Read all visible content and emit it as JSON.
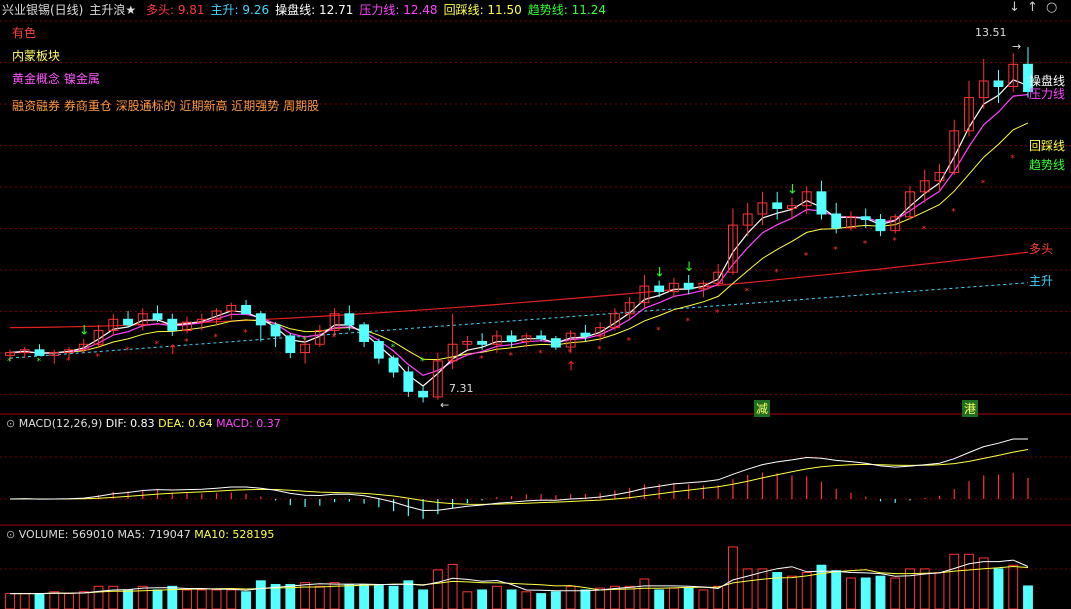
{
  "header": {
    "stock": "兴业银锡(日线)",
    "indicator": "主升浪★",
    "items": [
      {
        "label": "多头:",
        "value": "9.81",
        "color": "#ff3a3a"
      },
      {
        "label": "主升:",
        "value": "9.26",
        "color": "#3fd6ff"
      },
      {
        "label": "操盘线:",
        "value": "12.71",
        "color": "#ffffff"
      },
      {
        "label": "压力线:",
        "value": "12.48",
        "color": "#ff44ff"
      },
      {
        "label": "回踩线:",
        "value": "11.50",
        "color": "#ffff44"
      },
      {
        "label": "趋势线:",
        "value": "11.24",
        "color": "#33ff33"
      }
    ],
    "controls": [
      "↓",
      "↑",
      "○"
    ]
  },
  "tags": {
    "t1": "有色",
    "t2": "内蒙板块",
    "t3": "黄金概念 镍金属",
    "t4": "融资融券 券商重仓 深股通标的 近期新高 近期强势 周期股"
  },
  "labels": {
    "high": "13.51",
    "low": "7.31",
    "line1": "操盘线",
    "line2": "压力线",
    "line3": "回踩线",
    "line4": "趋势线",
    "line5": "多头",
    "line6": "主升",
    "mark1": "减",
    "mark2": "港"
  },
  "macd": {
    "name": "MACD(12,26,9)",
    "dif": "DIF: 0.83",
    "dea": "DEA: 0.64",
    "macd": "MACD: 0.37"
  },
  "volume": {
    "name": "VOLUME: 569010",
    "ma5": "MA5: 719047",
    "ma10": "MA10: 528195"
  },
  "colors": {
    "up": "#ff3333",
    "down": "#54ffff",
    "grid": "#7a0000",
    "bg": "#000000"
  },
  "chart_data": {
    "type": "candlestick",
    "y_range_price": [
      7.0,
      14.0
    ],
    "candles": [
      [
        7.95,
        8.05,
        7.85,
        8.0
      ],
      [
        8.0,
        8.1,
        7.9,
        8.05
      ],
      [
        8.05,
        8.15,
        7.95,
        7.95
      ],
      [
        7.95,
        8.05,
        7.8,
        8.0
      ],
      [
        8.0,
        8.1,
        7.9,
        8.05
      ],
      [
        8.05,
        8.25,
        8.0,
        8.15
      ],
      [
        8.15,
        8.5,
        8.1,
        8.4
      ],
      [
        8.4,
        8.7,
        8.3,
        8.6
      ],
      [
        8.6,
        8.75,
        8.45,
        8.5
      ],
      [
        8.5,
        8.8,
        8.4,
        8.7
      ],
      [
        8.7,
        8.85,
        8.55,
        8.6
      ],
      [
        8.6,
        8.7,
        8.3,
        8.4
      ],
      [
        8.4,
        8.65,
        8.35,
        8.55
      ],
      [
        8.55,
        8.7,
        8.4,
        8.6
      ],
      [
        8.6,
        8.8,
        8.5,
        8.75
      ],
      [
        8.75,
        8.9,
        8.6,
        8.85
      ],
      [
        8.85,
        8.95,
        8.7,
        8.7
      ],
      [
        8.7,
        8.75,
        8.2,
        8.5
      ],
      [
        8.5,
        8.55,
        8.1,
        8.3
      ],
      [
        8.3,
        8.35,
        7.9,
        8.0
      ],
      [
        8.0,
        8.3,
        7.8,
        8.15
      ],
      [
        8.15,
        8.5,
        8.1,
        8.4
      ],
      [
        8.4,
        8.8,
        8.3,
        8.7
      ],
      [
        8.7,
        8.85,
        8.4,
        8.5
      ],
      [
        8.5,
        8.55,
        8.1,
        8.2
      ],
      [
        8.2,
        8.25,
        7.8,
        7.9
      ],
      [
        7.9,
        7.95,
        7.55,
        7.65
      ],
      [
        7.65,
        7.75,
        7.2,
        7.3
      ],
      [
        7.3,
        7.4,
        7.1,
        7.2
      ],
      [
        7.2,
        8.0,
        7.15,
        7.85
      ],
      [
        7.85,
        8.7,
        7.7,
        8.15
      ],
      [
        8.15,
        8.3,
        8.05,
        8.2
      ],
      [
        8.2,
        8.35,
        8.05,
        8.15
      ],
      [
        8.15,
        8.4,
        8.0,
        8.3
      ],
      [
        8.3,
        8.4,
        8.1,
        8.2
      ],
      [
        8.2,
        8.35,
        8.1,
        8.3
      ],
      [
        8.3,
        8.4,
        8.2,
        8.25
      ],
      [
        8.25,
        8.3,
        8.05,
        8.1
      ],
      [
        8.1,
        8.4,
        8.0,
        8.35
      ],
      [
        8.35,
        8.5,
        8.2,
        8.3
      ],
      [
        8.3,
        8.55,
        8.2,
        8.45
      ],
      [
        8.45,
        8.8,
        8.4,
        8.7
      ],
      [
        8.7,
        9.0,
        8.6,
        8.9
      ],
      [
        8.9,
        9.4,
        8.8,
        9.2
      ],
      [
        9.2,
        9.3,
        9.0,
        9.1
      ],
      [
        9.1,
        9.35,
        9.0,
        9.25
      ],
      [
        9.25,
        9.4,
        9.05,
        9.15
      ],
      [
        9.15,
        9.3,
        9.0,
        9.25
      ],
      [
        9.25,
        9.6,
        9.2,
        9.45
      ],
      [
        9.45,
        10.6,
        9.4,
        10.3
      ],
      [
        10.3,
        10.7,
        10.1,
        10.5
      ],
      [
        10.5,
        10.9,
        10.3,
        10.7
      ],
      [
        10.7,
        10.9,
        10.4,
        10.6
      ],
      [
        10.6,
        10.8,
        10.4,
        10.65
      ],
      [
        10.65,
        11.0,
        10.5,
        10.9
      ],
      [
        10.9,
        11.1,
        10.4,
        10.5
      ],
      [
        10.5,
        10.7,
        10.15,
        10.25
      ],
      [
        10.25,
        10.55,
        10.2,
        10.45
      ],
      [
        10.45,
        10.6,
        10.25,
        10.4
      ],
      [
        10.4,
        10.5,
        10.1,
        10.2
      ],
      [
        10.2,
        10.5,
        10.15,
        10.45
      ],
      [
        10.45,
        11.0,
        10.4,
        10.9
      ],
      [
        10.9,
        11.3,
        10.7,
        11.1
      ],
      [
        11.1,
        11.4,
        10.9,
        11.25
      ],
      [
        11.25,
        12.2,
        11.2,
        12.0
      ],
      [
        12.0,
        12.9,
        11.9,
        12.6
      ],
      [
        12.6,
        13.3,
        12.4,
        12.9
      ],
      [
        12.9,
        13.1,
        12.5,
        12.8
      ],
      [
        12.8,
        13.4,
        12.7,
        13.2
      ],
      [
        13.2,
        13.51,
        12.6,
        12.71
      ]
    ],
    "ma_dashed_cyan": {
      "from": 7.9,
      "to": 9.26
    },
    "ma_red": {
      "from": 8.45,
      "to": 9.81
    },
    "macd_dif_end": 0.83,
    "macd_dea_end": 0.64,
    "volume_last": 569010
  }
}
